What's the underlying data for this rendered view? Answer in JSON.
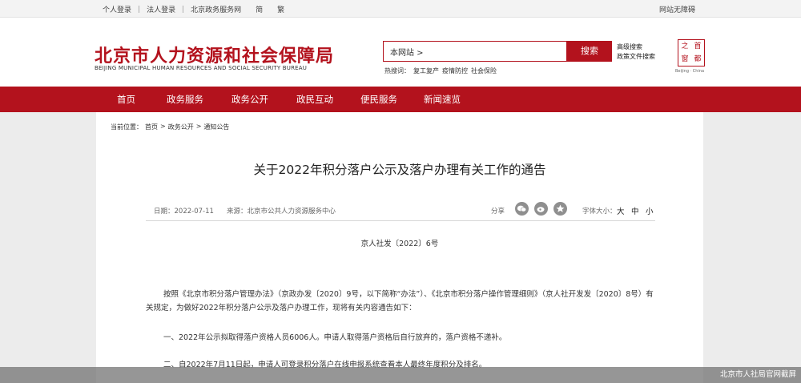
{
  "topbar": {
    "personal_login": "个人登录",
    "legal_login": "法人登录",
    "gov_service": "北京政务服务网",
    "simplified": "简",
    "traditional": "繁",
    "accessibility": "网站无障碍"
  },
  "header": {
    "title_cn": "北京市人力资源和社会保障局",
    "title_en": "BEIJING MUNICIPAL HUMAN RESOURCES AND SOCIAL SECURITY BUREAU",
    "search_value": "本网站 >",
    "search_button": "搜索",
    "advanced_search": "高级搜索",
    "policy_search": "政策文件搜索",
    "hot_label": "热搜词：",
    "hot_words": [
      "复工复产",
      "疫情防控",
      "社会保险"
    ],
    "emblem_chars": [
      "首",
      "都",
      "之",
      "窗"
    ],
    "emblem_caption": "Beijing · China"
  },
  "nav": {
    "items": [
      "首页",
      "政务服务",
      "政务公开",
      "政民互动",
      "便民服务",
      "新闻速览"
    ]
  },
  "breadcrumb": {
    "prefix": "当前位置：",
    "items": [
      "首页",
      "政务公开",
      "通知公告"
    ],
    "separator": ">"
  },
  "article": {
    "title": "关于2022年积分落户公示及落户办理有关工作的通告",
    "date": "日期：2022-07-11",
    "source": "来源：北京市公共人力资源服务中心",
    "share_label": "分享",
    "font_size_label": "字体大小：",
    "font_sizes": [
      "大",
      "中",
      "小"
    ],
    "doc_number": "京人社发〔2022〕6号",
    "paragraphs": [
      "按照《北京市积分落户管理办法》（京政办发〔2020〕9号，以下简称“办法”）、《北京市积分落户操作管理细则》（京人社开发发〔2020〕8号）有关规定，为做好2022年积分落户公示及落户办理工作，现将有关内容通告如下：",
      "一、2022年公示拟取得落户资格人员6006人。申请人取得落户资格后自行放弃的，落户资格不递补。",
      "二、自2022年7月11日起，申请人可登录积分落户在线申报系统查看本人最终年度积分及排名。"
    ]
  },
  "watermark": "北京市人社局官网截屏"
}
